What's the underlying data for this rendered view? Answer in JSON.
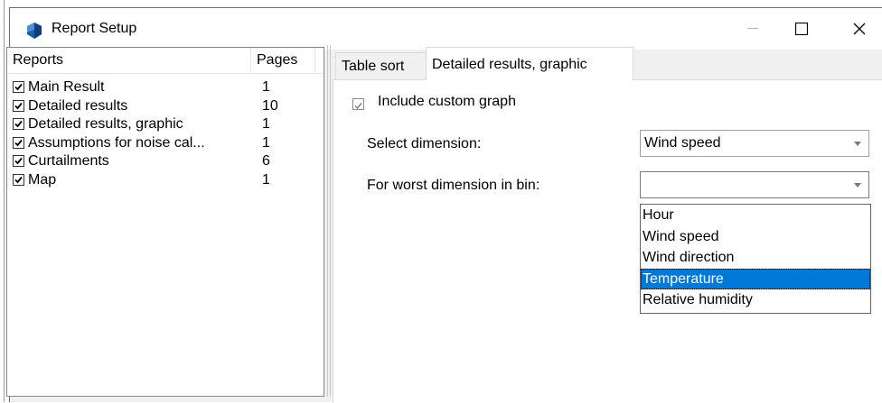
{
  "window": {
    "title": "Report Setup"
  },
  "reports": {
    "headers": {
      "name": "Reports",
      "pages": "Pages"
    },
    "items": [
      {
        "name": "Main Result",
        "pages": "1",
        "checked": true
      },
      {
        "name": "Detailed results",
        "pages": "10",
        "checked": true
      },
      {
        "name": "Detailed results, graphic",
        "pages": "1",
        "checked": true
      },
      {
        "name": "Assumptions for noise cal...",
        "pages": "1",
        "checked": true
      },
      {
        "name": "Curtailments",
        "pages": "6",
        "checked": true
      },
      {
        "name": "Map",
        "pages": "1",
        "checked": true
      }
    ]
  },
  "tabs": {
    "table_sort": "Table sort",
    "detailed_graphic": "Detailed results, graphic"
  },
  "graphic": {
    "include_custom_graph_label": "Include custom graph",
    "include_custom_graph_checked": true,
    "select_dimension_label": "Select dimension:",
    "select_dimension_value": "Wind speed",
    "worst_dimension_label": "For worst dimension in bin:",
    "worst_dimension_value": "",
    "dropdown_options": [
      "Hour",
      "Wind speed",
      "Wind direction",
      "Temperature",
      "Relative humidity"
    ],
    "highlighted_option": "Temperature"
  },
  "colors": {
    "selection": "#0078d7",
    "app_icon": "#1f5fa8"
  }
}
